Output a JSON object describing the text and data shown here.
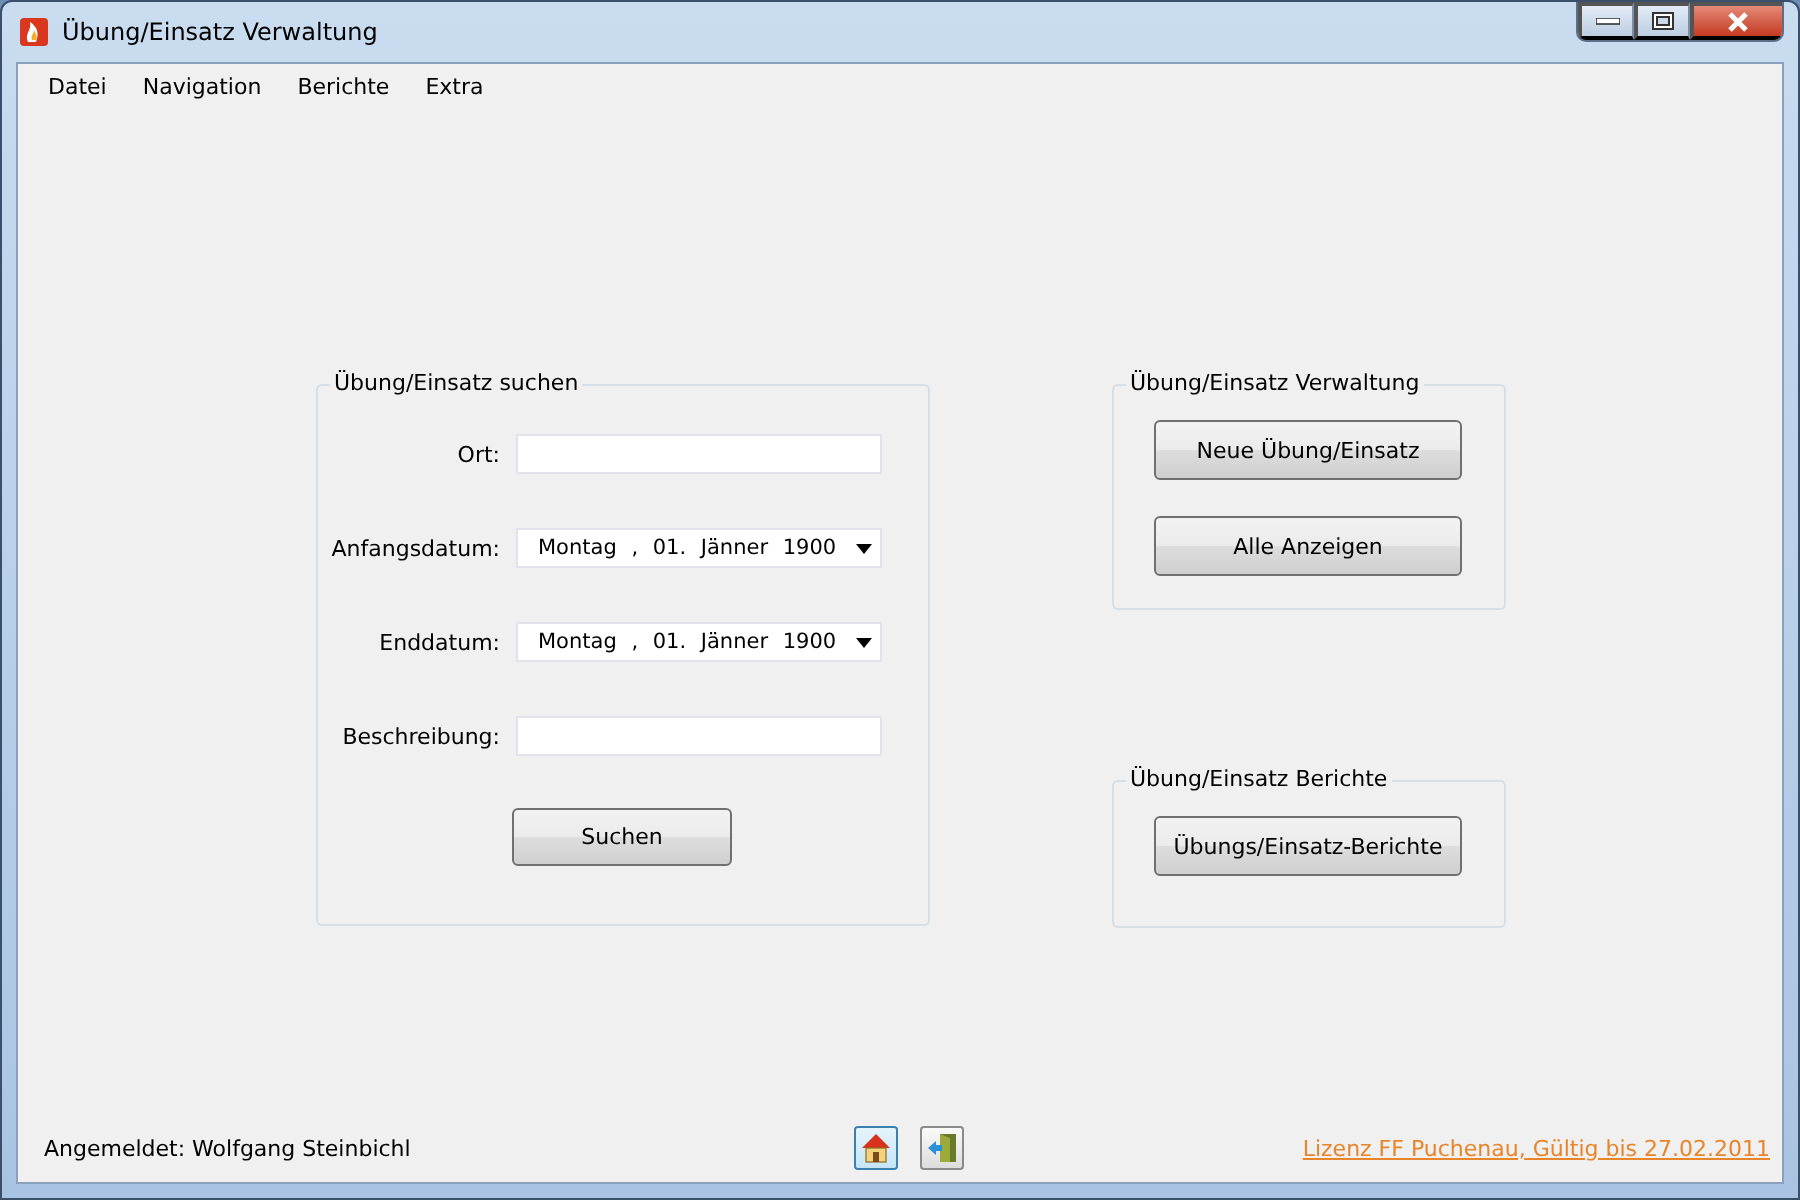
{
  "window": {
    "title": "Übung/Einsatz Verwaltung"
  },
  "menu": [
    "Datei",
    "Navigation",
    "Berichte",
    "Extra"
  ],
  "search_group": {
    "title": "Übung/Einsatz suchen",
    "fields": [
      {
        "kind": "text",
        "label": "Ort:"
      },
      {
        "kind": "date",
        "label": "Anfangsdatum:",
        "value": "Montag , 01. Jänner 1900"
      },
      {
        "kind": "date",
        "label": "Enddatum:",
        "value": "Montag , 01. Jänner 1900"
      },
      {
        "kind": "text",
        "label": "Beschreibung:"
      }
    ],
    "button": "Suchen"
  },
  "manage_group": {
    "title": "Übung/Einsatz Verwaltung",
    "buttons": [
      "Neue Übung/Einsatz",
      "Alle Anzeigen"
    ]
  },
  "reports_group": {
    "title": "Übung/Einsatz Berichte",
    "buttons": [
      "Übungs/Einsatz-Berichte"
    ]
  },
  "status_bar": {
    "user": "Angemeldet: Wolfgang Steinbichl",
    "tools": [
      {
        "kind": "home",
        "selected": true
      },
      {
        "kind": "exit",
        "selected": false
      }
    ],
    "license": "Lizenz FF Puchenau, Gültig bis 27.02.2011"
  }
}
